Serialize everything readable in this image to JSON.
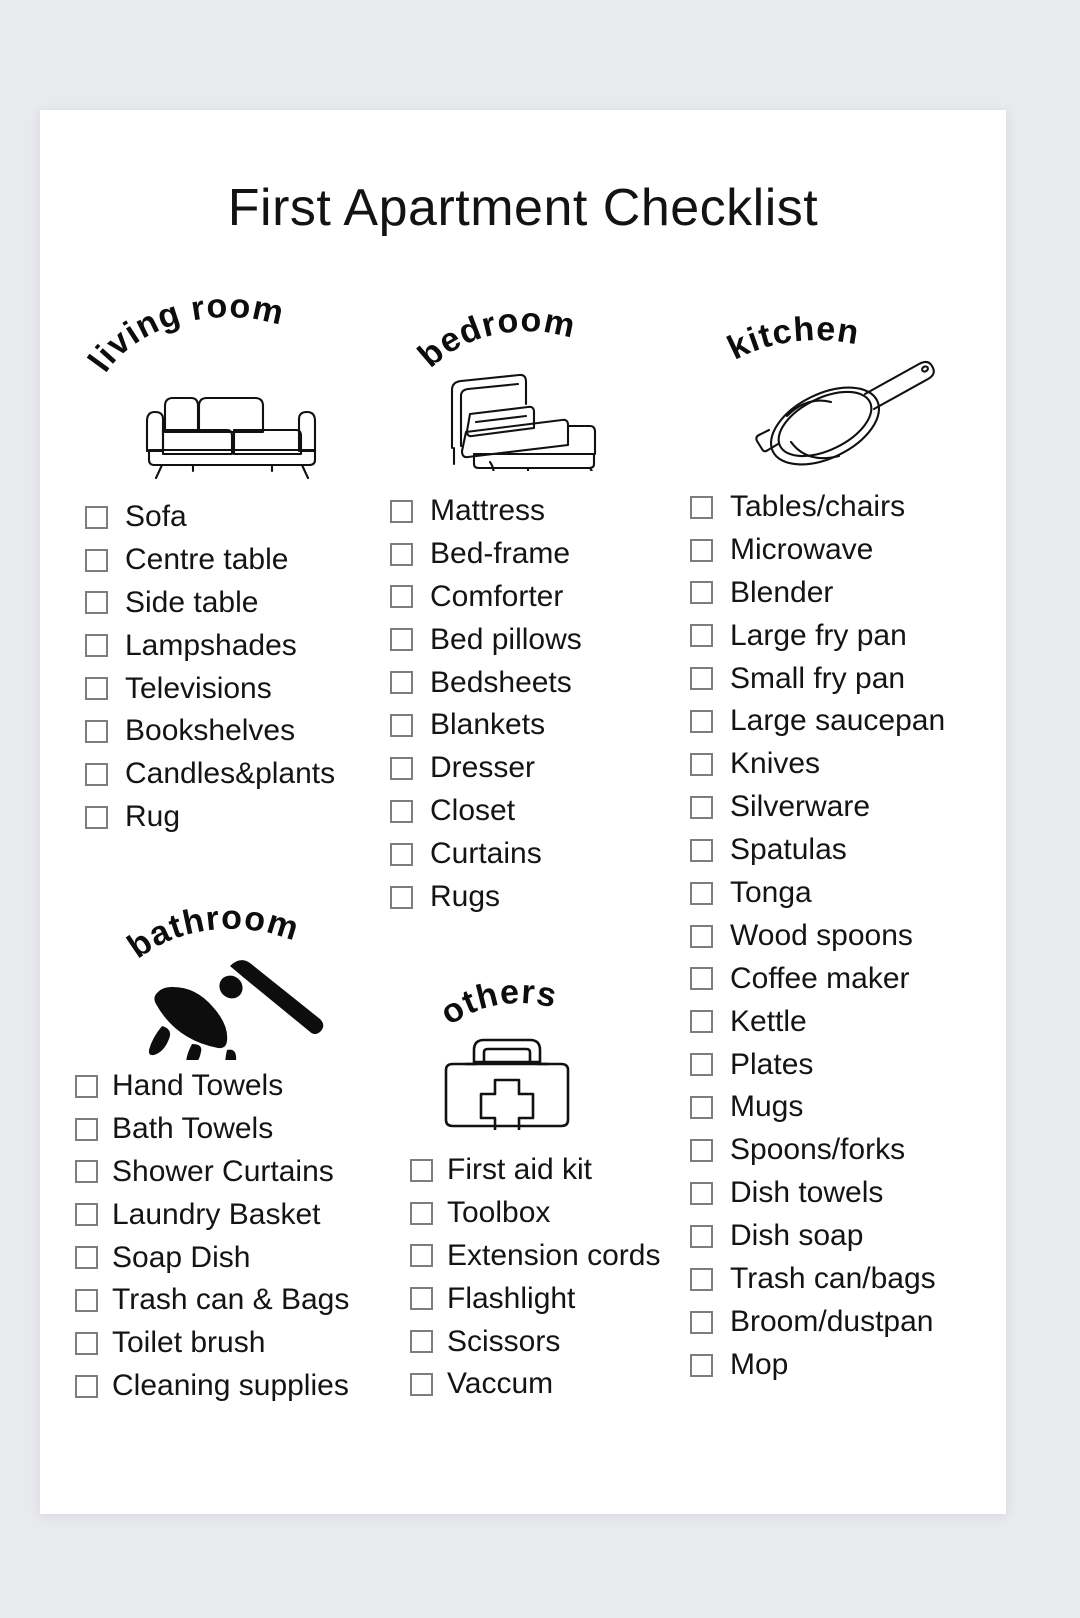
{
  "page": {
    "title": "First Apartment Checklist",
    "background_color": "#e8eaee",
    "sheet_color": "#ffffff",
    "text_color": "#141414",
    "checkbox_border_color": "#7c7c83"
  },
  "sections": [
    {
      "id": "living-room",
      "heading": "living room",
      "icon": "sofa-icon",
      "items": [
        "Sofa",
        "Centre table",
        "Side table",
        "Lampshades",
        "Televisions",
        "Bookshelves",
        "Candles&plants",
        "Rug"
      ]
    },
    {
      "id": "bedroom",
      "heading": "bedroom",
      "icon": "bed-icon",
      "items": [
        "Mattress",
        "Bed-frame",
        "Comforter",
        "Bed pillows",
        "Bedsheets",
        "Blankets",
        "Dresser",
        "Closet",
        "Curtains",
        "Rugs"
      ]
    },
    {
      "id": "kitchen",
      "heading": "kitchen",
      "icon": "frying-pan-icon",
      "items": [
        "Tables/chairs",
        "Microwave",
        "Blender",
        "Large fry pan",
        "Small fry pan",
        "Large saucepan",
        "Knives",
        "Silverware",
        "Spatulas",
        "Tonga",
        "Wood spoons",
        "Coffee maker",
        "Kettle",
        "Plates",
        "Mugs",
        "Spoons/forks",
        "Dish towels",
        "Dish soap",
        "Trash can/bags",
        "Broom/dustpan",
        "Mop"
      ]
    },
    {
      "id": "bathroom",
      "heading": "bathroom",
      "icon": "shower-head-icon",
      "items": [
        "Hand Towels",
        "Bath Towels",
        "Shower Curtains",
        "Laundry Basket",
        "Soap Dish",
        "Trash can & Bags",
        "Toilet brush",
        "Cleaning supplies"
      ]
    },
    {
      "id": "others",
      "heading": "others",
      "icon": "first-aid-kit-icon",
      "items": [
        "First aid kit",
        "Toolbox",
        "Extension cords",
        "Flashlight",
        "Scissors",
        "Vaccum"
      ]
    }
  ]
}
